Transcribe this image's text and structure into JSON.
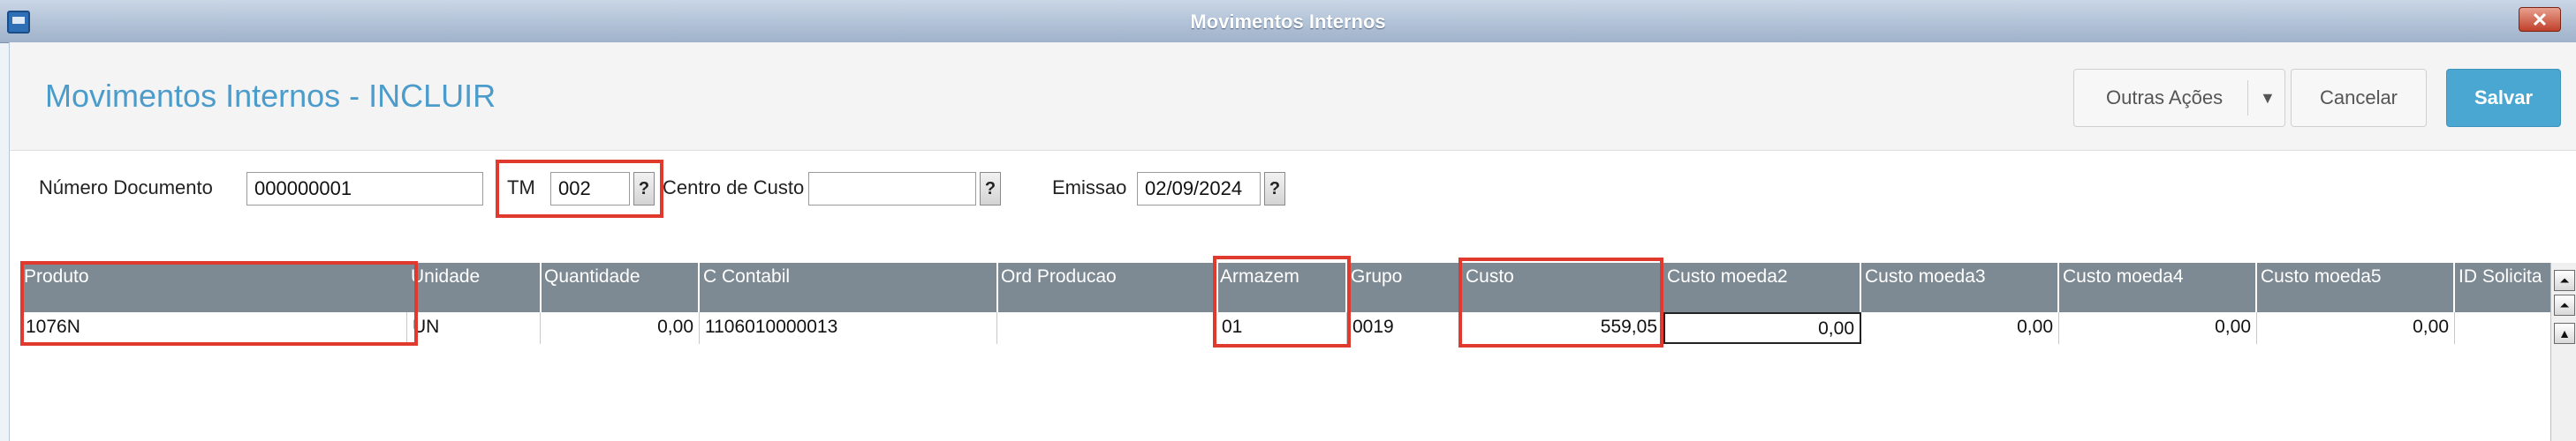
{
  "window": {
    "title": "Movimentos Internos",
    "close_glyph": "✕"
  },
  "header": {
    "page_title": "Movimentos Internos - INCLUIR",
    "other_actions_label": "Outras Ações",
    "other_actions_chevron": "▼",
    "cancel_label": "Cancelar",
    "save_label": "Salvar"
  },
  "form": {
    "numero_documento": {
      "label": "Número Documento",
      "value": "000000001"
    },
    "tm": {
      "label": "TM",
      "value": "002"
    },
    "centro_custo": {
      "label": "Centro de Custo",
      "value": ""
    },
    "emissao": {
      "label": "Emissao",
      "value": "02/09/2024"
    },
    "lookup_glyph": "?"
  },
  "grid": {
    "columns": [
      "Produto",
      "Unidade",
      "Quantidade",
      "C Contabil",
      "Ord Producao",
      "Armazem",
      "Grupo",
      "Custo",
      "Custo moeda2",
      "Custo moeda3",
      "Custo moeda4",
      "Custo moeda5",
      "ID Solicita"
    ],
    "rows": [
      [
        "1076N",
        "UN",
        "0,00",
        "1106010000013",
        "",
        "01",
        "0019",
        "559,05",
        "0,00",
        "0,00",
        "0,00",
        "0,00",
        ""
      ]
    ]
  },
  "scrollbar": {
    "top_glyph": "⏶",
    "up_glyph": "▲"
  },
  "colors": {
    "accent": "#4aa7d2",
    "title_blue": "#4b9bcb",
    "grid_header": "#7e8a93",
    "highlight": "#e03a2e"
  }
}
